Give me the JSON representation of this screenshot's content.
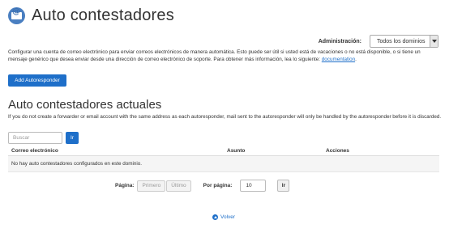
{
  "header": {
    "title": "Auto contestadores",
    "icon": "email-autoresponder-icon"
  },
  "admin": {
    "label": "Administración:",
    "selected_domain": "Todos los dominios"
  },
  "description": {
    "text": "Configurar una cuenta de correo electrónico para enviar correos electrónicos de manera automática. Esto puede ser útil si usted está de vacaciones o no está disponible, o si tiene un mensaje genérico que desea enviar desde una dirección de correo electrónico de soporte. Para obtener más información, lea lo siguiente: ",
    "link": "documentation",
    "end": "."
  },
  "add_button": "Add Autoresponder",
  "current": {
    "title": "Auto contestadores actuales",
    "note": "If you do not create a forwarder or email account with the same address as each autoresponder, mail sent to the autoresponder will only be handled by the autoresponder before it is discarded."
  },
  "search": {
    "placeholder": "Buscar",
    "button": "Ir"
  },
  "table": {
    "columns": [
      "Correo electrónico",
      "Asunto",
      "Acciones"
    ],
    "empty_message": "No hay auto contestadores configurados en este dominio."
  },
  "pagination": {
    "page_label": "Página:",
    "first": "Primero",
    "last": "Último",
    "per_page_label": "Por página:",
    "per_page_value": "10",
    "go": "Ir"
  },
  "back_link": "Volver",
  "colors": {
    "accent": "#1e6fc9",
    "icon": "#4a7fc1"
  }
}
